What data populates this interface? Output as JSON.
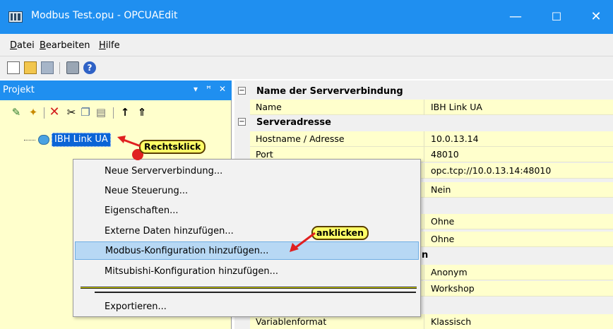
{
  "window": {
    "title": "Modbus Test.opu - OPCUAEdit",
    "controls": [
      "—",
      "☐",
      "✕"
    ]
  },
  "menu": [
    {
      "label": "Datei",
      "accel": "D",
      "rest": "atei"
    },
    {
      "label": "Bearbeiten",
      "accel": "B",
      "rest": "earbeiten"
    },
    {
      "label": "Hilfe",
      "accel": "H",
      "rest": "ilfe"
    }
  ],
  "toolbar_icons": [
    "new-document-icon",
    "open-folder-icon",
    "save-icon",
    "print-icon",
    "help-icon"
  ],
  "panel": {
    "title": "Projekt",
    "header_buttons": [
      "▾",
      "ꟸ",
      "✕"
    ],
    "tool_icons": [
      "new-connection-icon",
      "new-item-icon",
      "delete-icon",
      "cut-icon",
      "copy-icon",
      "paste-icon",
      "move-up-icon",
      "move-top-icon"
    ],
    "tree_item": "IBH Link UA"
  },
  "grid": {
    "categories": [
      {
        "label": "Name der Serververbindung",
        "rows": [
          {
            "name": "Name",
            "value": "IBH Link UA"
          }
        ]
      },
      {
        "label": "Serveradresse",
        "rows": [
          {
            "name": "Hostname / Adresse",
            "value": "10.0.13.14"
          },
          {
            "name": "Port",
            "value": "48010"
          },
          {
            "name": "",
            "value": "opc.tcp://10.0.13.14:48010"
          },
          {
            "name": "",
            "value": "Nein"
          }
        ]
      }
    ],
    "more_rows": [
      {
        "name": "",
        "value": "Ohne"
      },
      {
        "name": "",
        "value": "Ohne"
      },
      {
        "name": "",
        "value": "Anonym"
      },
      {
        "name": "",
        "value": "Workshop"
      },
      {
        "name": "Variablenformat",
        "value": "Klassisch"
      }
    ],
    "partial_char": "n"
  },
  "context_menu": {
    "items": [
      "Neue Serververbindung...",
      "Neue Steuerung...",
      "Eigenschaften...",
      "Externe Daten hinzufügen...",
      "Modbus-Konfiguration hinzufügen...",
      "Mitsubishi-Konfiguration hinzufügen...",
      "Exportieren..."
    ],
    "highlighted_index": 4
  },
  "annotations": {
    "rechtsklick": "Rechtsklick",
    "anklicken": "anklicken",
    "accent_color": "#ffff66",
    "arrow_color": "#e02020"
  }
}
